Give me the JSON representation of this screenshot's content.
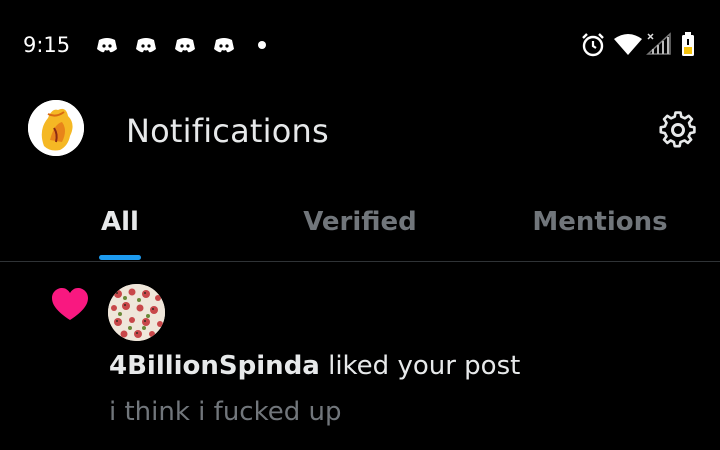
{
  "status_bar": {
    "time": "9:15",
    "icons": [
      "discord-icon",
      "discord-icon",
      "discord-icon",
      "discord-icon",
      "more-notifications-dot-icon",
      "alarm-icon",
      "wifi-icon",
      "cell-signal-icon",
      "battery-icon"
    ]
  },
  "header": {
    "title": "Notifications",
    "avatar": "profile-avatar",
    "settings_icon": "gear-icon"
  },
  "tabs": [
    {
      "label": "All",
      "active": true
    },
    {
      "label": "Verified",
      "active": false
    },
    {
      "label": "Mentions",
      "active": false
    }
  ],
  "notifications": [
    {
      "type_icon": "heart-icon",
      "username": "4BillionSpinda",
      "action": " liked your post",
      "post_text": "i think i fucked up"
    }
  ],
  "colors": {
    "background": "#000000",
    "primary_text": "#e7e9ea",
    "secondary_text": "#71767b",
    "accent": "#1d9bf0",
    "like": "#f91880",
    "divider": "#2f3336"
  }
}
